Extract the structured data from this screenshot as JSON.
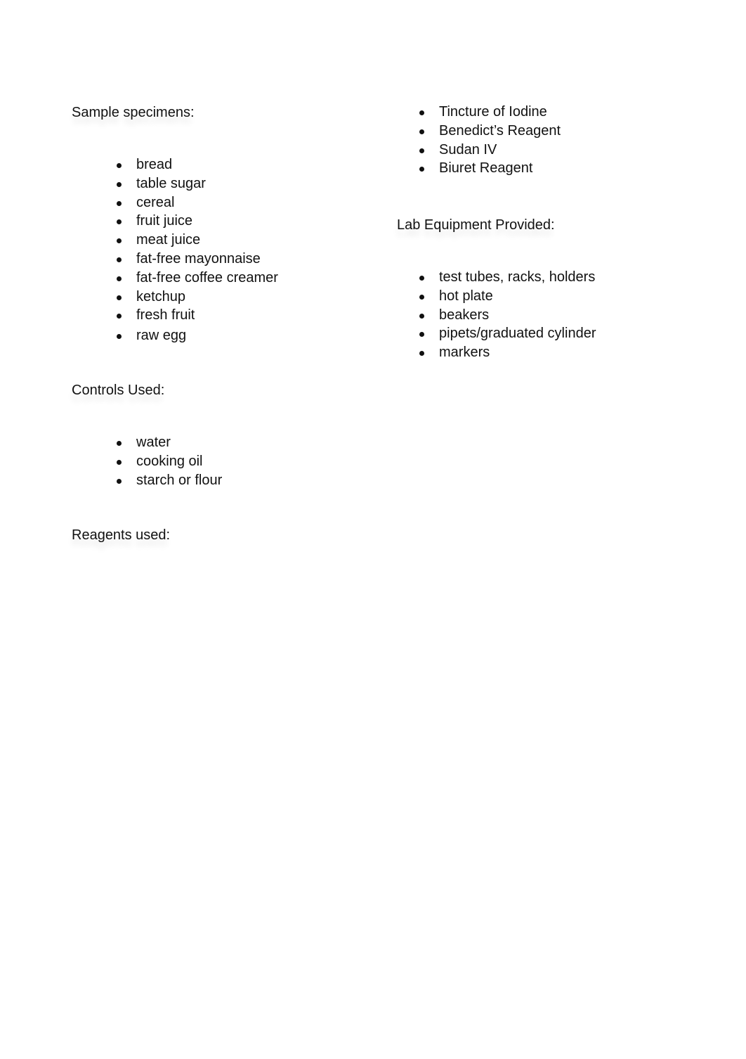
{
  "document": {
    "sections": {
      "specimens": {
        "heading": "Sample specimens:",
        "items": [
          "bread",
          "table sugar",
          "cereal",
          "fruit juice",
          "meat juice",
          "fat-free mayonnaise",
          "fat-free coffee creamer",
          "ketchup",
          "fresh fruit",
          "raw egg"
        ]
      },
      "controls": {
        "heading": "Controls Used:",
        "items": [
          "water",
          "cooking oil",
          "starch or flour"
        ]
      },
      "reagents": {
        "heading": "Reagents used:",
        "items": [
          "Tincture of Iodine",
          "Benedict’s Reagent",
          "Sudan IV",
          "Biuret Reagent"
        ]
      },
      "equipment": {
        "heading": "Lab Equipment Provided:",
        "items": [
          "test tubes, racks, holders",
          "hot plate",
          "beakers",
          "pipets/graduated cylinder",
          "markers"
        ]
      }
    },
    "colors": {
      "text": "#111111",
      "background": "#ffffff"
    },
    "icons": {
      "bullet": "bullet-icon"
    }
  }
}
